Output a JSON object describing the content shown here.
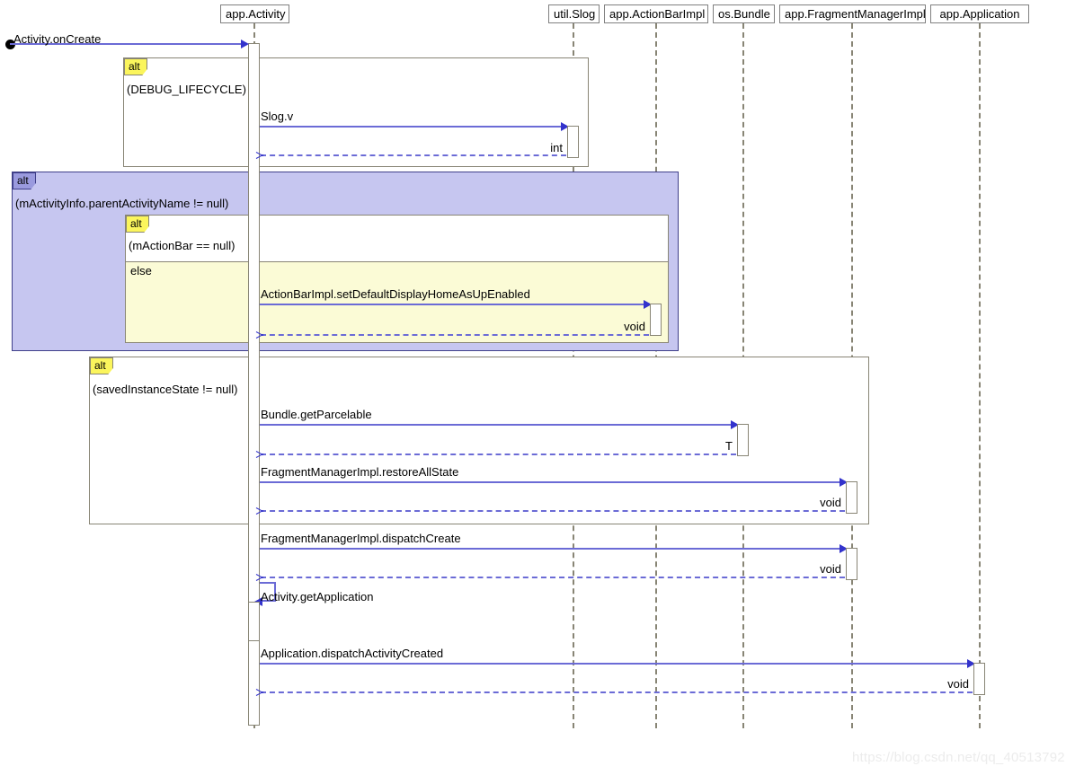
{
  "diagram": {
    "title": "Activity.onCreate sequence diagram",
    "type": "uml-sequence-diagram",
    "colors": {
      "message_line": "#6b6bd6",
      "arrow_head": "#3333cc",
      "lifeline": "#888575",
      "frame_border": "#888575",
      "alt_label_yellow": "#fbf55c",
      "alt_label_purple": "#9a9ade",
      "frame_fill_purple": "#c6c6f0",
      "frame_fill_yellow": "#fbfbd6",
      "frame_fill_white": "#ffffff",
      "watermark": "#ececec"
    }
  },
  "participants": [
    {
      "id": "activity",
      "label": "app.Activity"
    },
    {
      "id": "slog",
      "label": "util.Slog"
    },
    {
      "id": "actionbar",
      "label": "app.ActionBarImpl"
    },
    {
      "id": "bundle",
      "label": "os.Bundle"
    },
    {
      "id": "fragmgr",
      "label": "app.FragmentManagerImpl"
    },
    {
      "id": "app",
      "label": "app.Application"
    }
  ],
  "entry_message": {
    "label": "Activity.onCreate",
    "kind": "found-message"
  },
  "fragments": [
    {
      "id": "frag-debug",
      "operator": "alt",
      "condition": "(DEBUG_LIFECYCLE)"
    },
    {
      "id": "frag-parent",
      "operator": "alt",
      "condition": "(mActivityInfo.parentActivityName != null)"
    },
    {
      "id": "frag-actionbar",
      "operator": "alt",
      "condition": "(mActionBar == null)",
      "else_label": "else"
    },
    {
      "id": "frag-saved",
      "operator": "alt",
      "condition": "(savedInstanceState != null)"
    }
  ],
  "messages": [
    {
      "id": "m1",
      "from": "activity",
      "to": "slog",
      "label": "Slog.v",
      "return_label": "int"
    },
    {
      "id": "m2",
      "from": "activity",
      "to": "actionbar",
      "label": "ActionBarImpl.setDefaultDisplayHomeAsUpEnabled",
      "return_label": "void"
    },
    {
      "id": "m3",
      "from": "activity",
      "to": "bundle",
      "label": "Bundle.getParcelable",
      "return_label": "T"
    },
    {
      "id": "m4",
      "from": "activity",
      "to": "fragmgr",
      "label": "FragmentManagerImpl.restoreAllState",
      "return_label": "void"
    },
    {
      "id": "m5",
      "from": "activity",
      "to": "fragmgr",
      "label": "FragmentManagerImpl.dispatchCreate",
      "return_label": "void"
    },
    {
      "id": "m6",
      "from": "activity",
      "to": "activity",
      "label": "Activity.getApplication",
      "return_label": ""
    },
    {
      "id": "m7",
      "from": "activity",
      "to": "app",
      "label": "Application.dispatchActivityCreated",
      "return_label": "void"
    }
  ],
  "watermark": {
    "text": "https://blog.csdn.net/qq_40513792"
  }
}
